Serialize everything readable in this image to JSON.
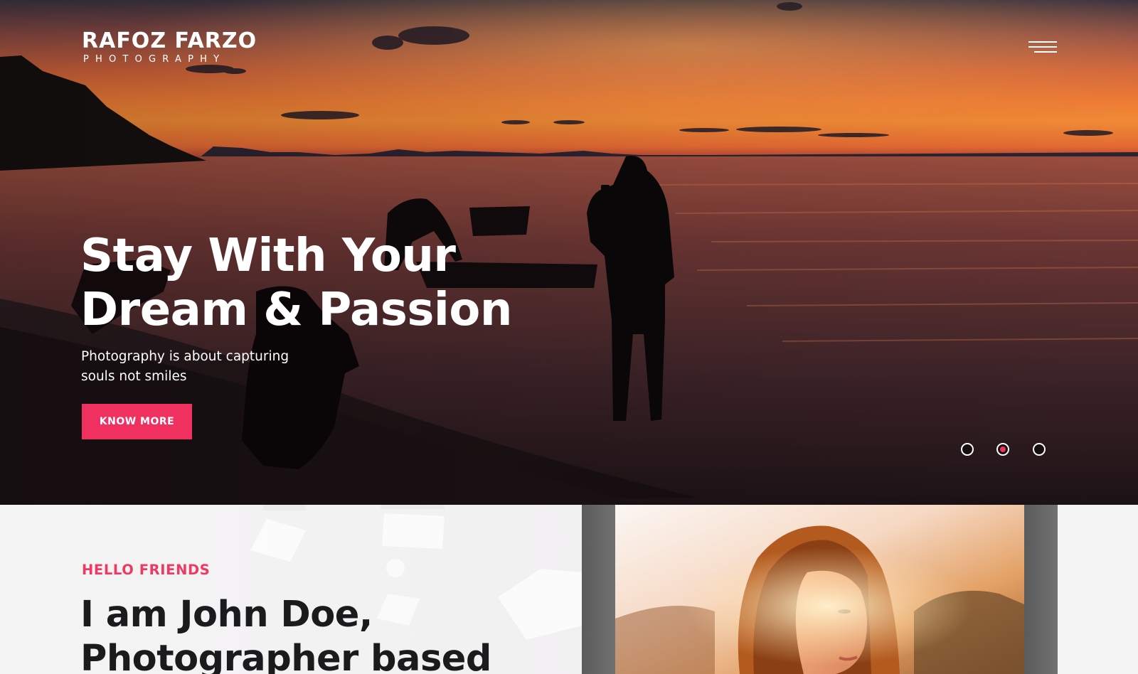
{
  "brand": {
    "name": "RAFOZ FARZO",
    "tagline": "PHOTOGRAPHY"
  },
  "header": {
    "menu_icon": "hamburger-menu-icon"
  },
  "hero": {
    "title_line1": "Stay With Your",
    "title_line2": "Dream & Passion",
    "subtitle": "Photography is about capturing souls not smiles",
    "cta_label": "KNOW MORE",
    "slides": {
      "count": 3,
      "active_index": 1
    }
  },
  "about": {
    "eyebrow": "HELLO FRIENDS",
    "heading_line1": "I am John Doe,",
    "heading_line2": "Photographer based"
  },
  "colors": {
    "accent": "#f0305f",
    "eyebrow": "#ee3a63",
    "heading": "#1b1b1d",
    "dot_active": "#f0305f"
  }
}
